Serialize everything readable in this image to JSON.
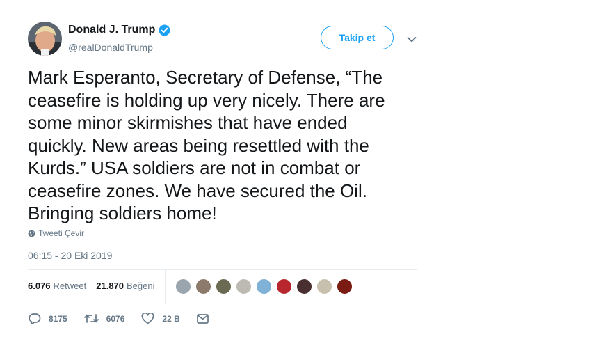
{
  "author": {
    "name": "Donald J. Trump",
    "handle": "@realDonaldTrump",
    "verified": true,
    "accent_color": "#1da1f2"
  },
  "follow_button": {
    "label": "Takip et"
  },
  "tweet": {
    "text": "Mark Esperanto, Secretary of Defense, “The\nceasefire is holding up very nicely. There are\nsome minor skirmishes that have ended\nquickly. New areas being resettled with the\nKurds.” USA soldiers are not in combat or\nceasefire zones. We have secured the Oil.\nBringing soldiers home!",
    "translate_label": "Tweeti Çevir",
    "timestamp": "06:15 - 20 Eki 2019"
  },
  "stats": {
    "retweet_count": "6.076",
    "retweet_label": "Retweet",
    "like_count": "21.870",
    "like_label": "Beğeni"
  },
  "liker_avatar_colors": [
    "#9aa5ae",
    "#8c7a6b",
    "#6b6a52",
    "#bdbab3",
    "#7fb2d6",
    "#b8262e",
    "#4a2f31",
    "#c7c0ad",
    "#7a1b14"
  ],
  "actions": {
    "reply_count": "8175",
    "retweet_count": "6076",
    "like_count": "22 B"
  },
  "icons": [
    "verified-badge-icon",
    "chevron-down-icon",
    "globe-icon",
    "reply-icon",
    "retweet-icon",
    "heart-icon",
    "envelope-icon"
  ]
}
